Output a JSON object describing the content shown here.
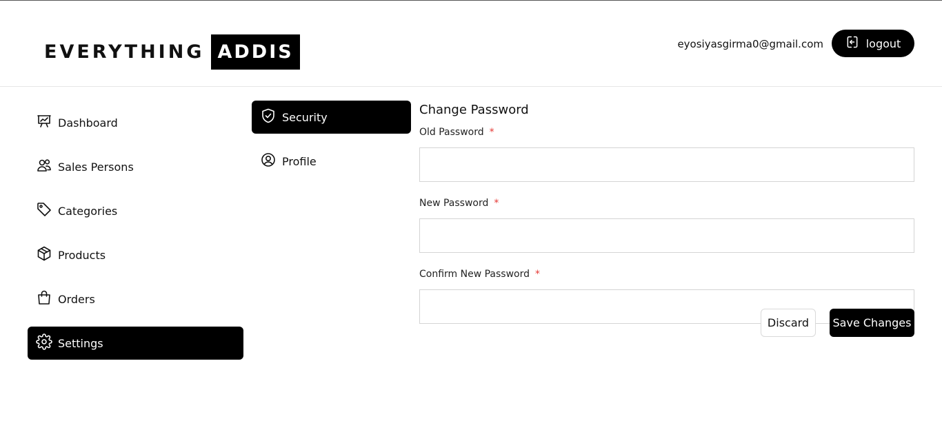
{
  "brand": {
    "part1": "EVERYTHING",
    "part2": "ADDIS"
  },
  "header": {
    "user_email": "eyosiyasgirma0@gmail.com",
    "logout_label": "logout"
  },
  "sidebar": {
    "items": [
      {
        "label": "Dashboard",
        "icon": "presentation-chart-icon",
        "active": false
      },
      {
        "label": "Sales Persons",
        "icon": "users-icon",
        "active": false
      },
      {
        "label": "Categories",
        "icon": "tag-icon",
        "active": false
      },
      {
        "label": "Products",
        "icon": "box-icon",
        "active": false
      },
      {
        "label": "Orders",
        "icon": "shopping-bag-icon",
        "active": false
      },
      {
        "label": "Settings",
        "icon": "gear-icon",
        "active": true
      }
    ]
  },
  "settings_nav": {
    "items": [
      {
        "label": "Security",
        "icon": "shield-check-icon",
        "active": true
      },
      {
        "label": "Profile",
        "icon": "user-circle-icon",
        "active": false
      }
    ]
  },
  "form": {
    "title": "Change Password",
    "required_mark": "*",
    "fields": [
      {
        "label": "Old Password",
        "value": "",
        "placeholder": ""
      },
      {
        "label": "New Password",
        "value": "",
        "placeholder": ""
      },
      {
        "label": "Confirm New Password",
        "value": "",
        "placeholder": ""
      }
    ],
    "discard_label": "Discard",
    "save_label": "Save Changes"
  },
  "colors": {
    "accent": "#000000",
    "required": "#e53935",
    "border": "#d4d4d4"
  }
}
